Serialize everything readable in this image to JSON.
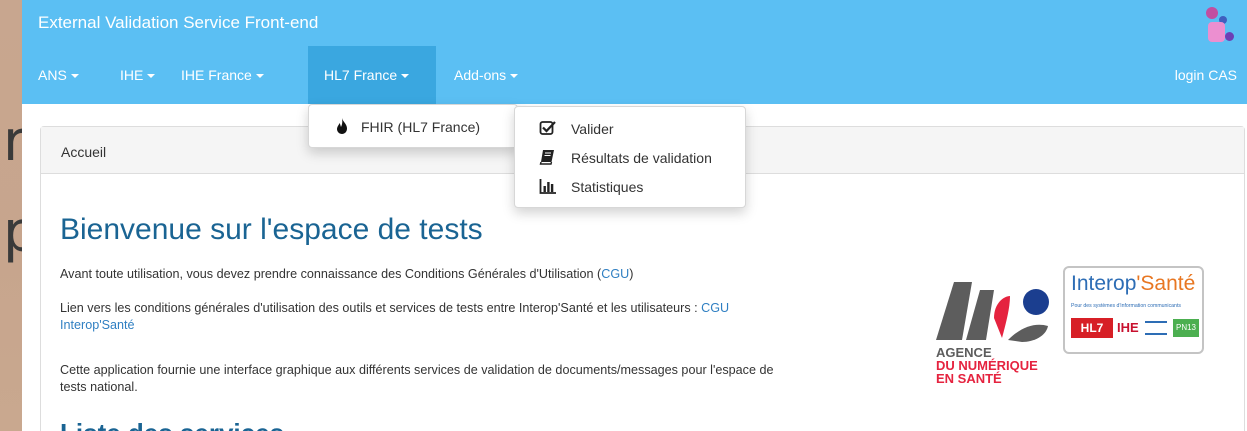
{
  "window": {
    "title": "External Validation Service Front-end"
  },
  "navbar": {
    "items": [
      {
        "label": "ANS"
      },
      {
        "label": "IHE"
      },
      {
        "label": "IHE France"
      },
      {
        "label": "HL7 France"
      },
      {
        "label": "Add-ons"
      }
    ],
    "right_label": "login CAS",
    "active": "HL7 France"
  },
  "hl7_dropdown": {
    "items": [
      {
        "label": "FHIR (HL7 France)",
        "icon": "fire-icon"
      }
    ]
  },
  "fhir_submenu": {
    "items": [
      {
        "label": "Valider",
        "icon": "check-square-icon"
      },
      {
        "label": "Résultats de validation",
        "icon": "book-icon"
      },
      {
        "label": "Statistiques",
        "icon": "bar-chart-icon"
      }
    ]
  },
  "panel": {
    "heading": "Accueil"
  },
  "content": {
    "title": "Bienvenue sur l'espace de tests",
    "para1_text": "Avant toute utilisation, vous devez prendre connaissance des Conditions Générales d'Utilisation (",
    "para1_link": "CGU",
    "para1_end": ")",
    "para2_text": "Lien vers les conditions générales d'utilisation des outils et services de tests entre Interop'Santé et les utilisateurs : ",
    "para2_link_line1": "CGU",
    "para2_link_line2": "Interop'Santé",
    "para3_line1": "Cette application fournie une interface graphique aux différents services de validation de documents/messages pour l'espace de",
    "para3_line2": "tests national.",
    "section_title": "Liste des services"
  },
  "logos": {
    "ans": {
      "line1": "AGENCE",
      "line2": "DU NUMÉRIQUE",
      "line3": "EN SANTÉ"
    },
    "interop": {
      "name1": "Interop",
      "name2": "Santé",
      "tagline": "Pour des systèmes d'information communicants",
      "hl7": "HL7",
      "ihe": "IHE",
      "pn13": "PN13"
    }
  },
  "colors": {
    "navbar": "#5bbff3",
    "navbar_active": "#3aa7e0",
    "title_blue": "#1a6493",
    "link": "#2f7fc2",
    "ans_grey": "#5d5d5d",
    "ans_red": "#e5233f",
    "ans_blue": "#1b3e8f"
  }
}
